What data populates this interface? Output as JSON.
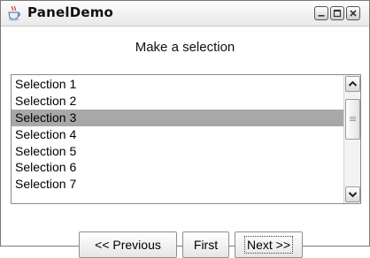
{
  "window": {
    "title": "PanelDemo"
  },
  "main": {
    "heading": "Make a selection"
  },
  "list": {
    "items": [
      "Selection 1",
      "Selection 2",
      "Selection 3",
      "Selection 4",
      "Selection 5",
      "Selection 6",
      "Selection 7"
    ],
    "selected": "Selection 3"
  },
  "buttons": {
    "previous": "<< Previous",
    "first": "First",
    "next": "Next >>"
  },
  "colors": {
    "selection_highlight": "#a8a8a8",
    "window_background": "#ffffff"
  }
}
